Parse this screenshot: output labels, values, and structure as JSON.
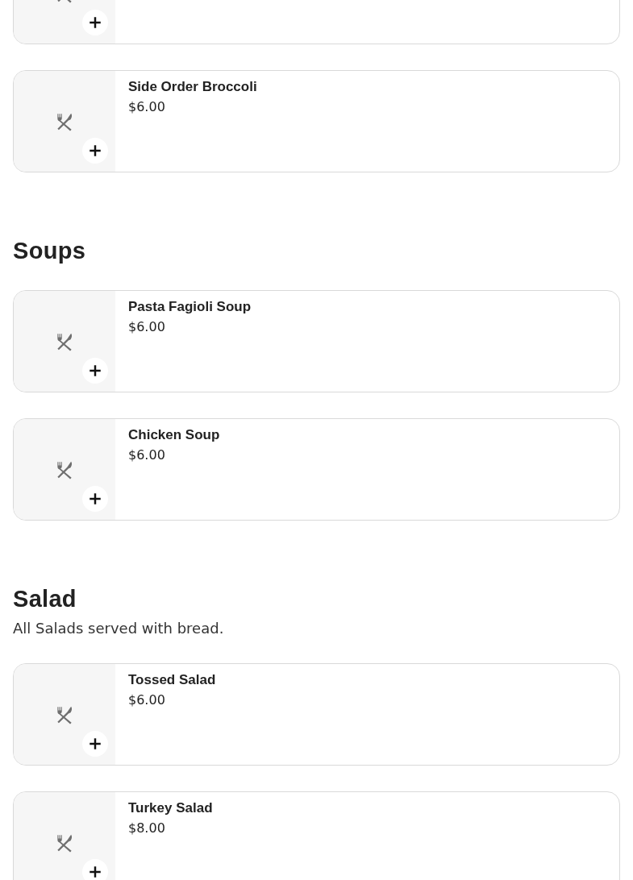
{
  "sections": [
    {
      "items": [
        {
          "kind": "cut"
        },
        {
          "kind": "item",
          "name": "Side Order Broccoli",
          "price": "$6.00"
        }
      ]
    },
    {
      "title": "Soups",
      "items": [
        {
          "kind": "item",
          "name": "Pasta Fagioli Soup",
          "price": "$6.00"
        },
        {
          "kind": "item",
          "name": "Chicken Soup",
          "price": "$6.00"
        }
      ]
    },
    {
      "title": "Salad",
      "description": "All Salads served with bread.",
      "items": [
        {
          "kind": "item",
          "name": "Tossed Salad",
          "price": "$6.00"
        },
        {
          "kind": "item",
          "name": "Turkey Salad",
          "price": "$8.00"
        }
      ]
    }
  ]
}
